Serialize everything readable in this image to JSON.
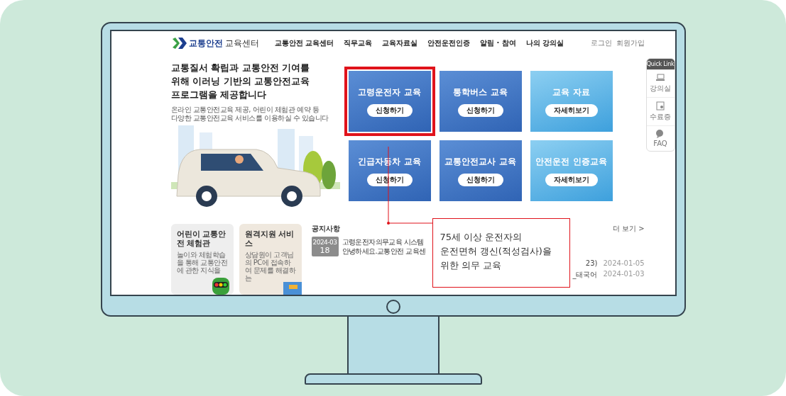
{
  "header": {
    "logo": {
      "brand": "교통안전",
      "suffix": "교육센터"
    },
    "nav": [
      "교통안전 교육센터",
      "직무교육",
      "교육자료실",
      "안전운전인증",
      "알림 · 참여",
      "나의 강의실"
    ],
    "links": [
      "로그인",
      "회원가입"
    ]
  },
  "hero": {
    "heading": [
      "교통질서 확립과 교통안전 기여를",
      "위해 이러닝 기반의 교통안전교육",
      "프로그램을 제공합니다"
    ],
    "subtitle": [
      "온라인 교통안전교육 제공, 어린이 체험관 예약 등",
      "다양한 교통안전교육 서비스를 이용하실 수 있습니다"
    ]
  },
  "cards": [
    {
      "title": "고령운전자 교육",
      "button": "신청하기",
      "kind": "dark",
      "highlighted": true
    },
    {
      "title": "통학버스 교육",
      "button": "신청하기",
      "kind": "dark",
      "highlighted": false
    },
    {
      "title": "교육 자료",
      "button": "자세히보기",
      "kind": "light",
      "highlighted": false
    },
    {
      "title": "긴급자동차 교육",
      "button": "신청하기",
      "kind": "dark",
      "highlighted": false
    },
    {
      "title": "교통안전교사 교육",
      "button": "신청하기",
      "kind": "dark",
      "highlighted": false
    },
    {
      "title": "안전운전 인증교육",
      "button": "자세히보기",
      "kind": "light",
      "highlighted": false
    }
  ],
  "quick_link": {
    "title": "Quick Link",
    "items": [
      {
        "label": "강의실",
        "kind": "lecture"
      },
      {
        "label": "수료증",
        "kind": "certificate"
      },
      {
        "label": "FAQ",
        "kind": "faq"
      }
    ]
  },
  "promos": [
    {
      "title": "어린이 교통안전 체험관",
      "description": "놀이와 체험학습을 통해 교통안전에 관한 지식을",
      "kind": "kids"
    },
    {
      "title": "원격지원 서비스",
      "description": "상담원이 고객님의 PC에 접속하여 문제를 해결하는",
      "kind": "remote"
    }
  ],
  "notices": {
    "title": "공지사항",
    "more": "더 보기 >",
    "featured": {
      "month": "2024-03",
      "day": "18",
      "lines": [
        "고령운전자의무교육 시스템",
        "안녕하세요.교통안전 교육센"
      ]
    },
    "rows": [
      {
        "title": "23)",
        "date": "2024-01-05"
      },
      {
        "title": "_태국어",
        "date": "2024-01-03"
      }
    ]
  },
  "callout": {
    "lines": [
      "75세 이상 운전자의",
      "운전면허 갱신(적성검사)을",
      "위한 의무 교육"
    ]
  }
}
